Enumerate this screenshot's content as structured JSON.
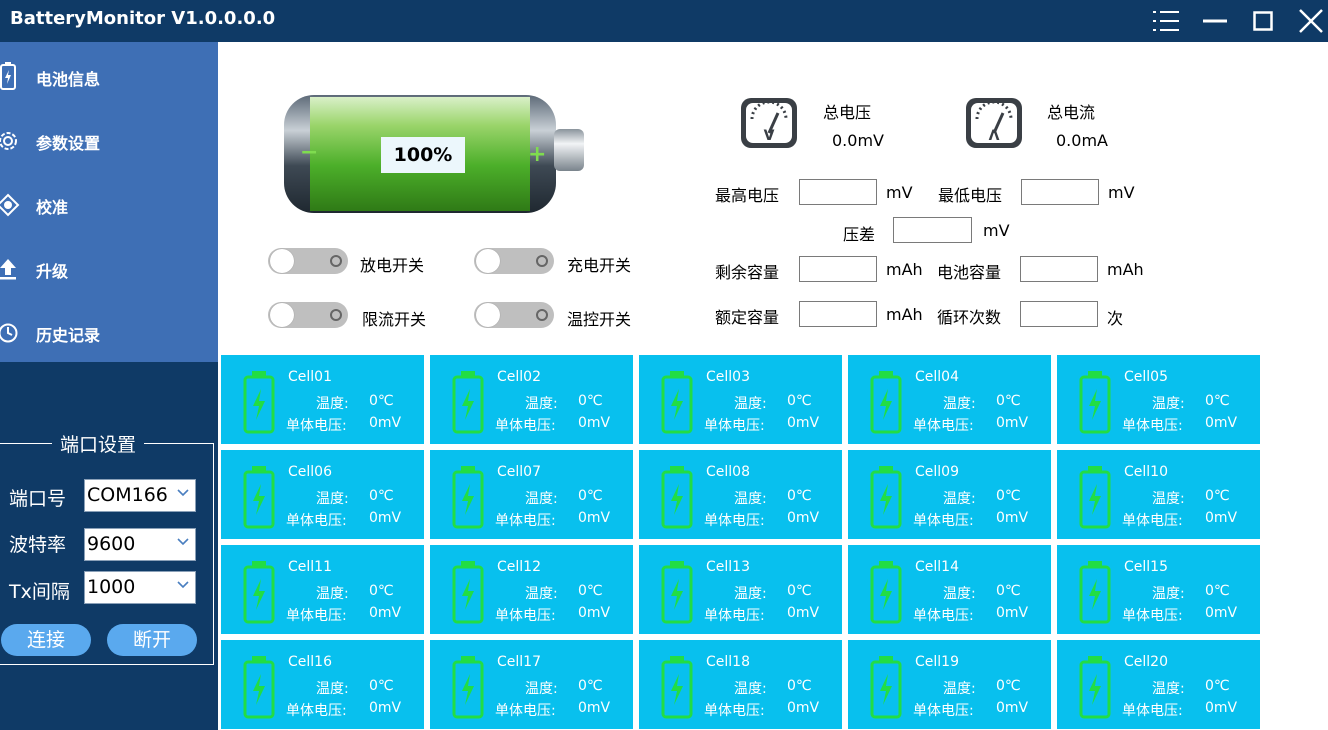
{
  "window": {
    "title": "BatteryMonitor V1.0.0.0.0",
    "buttons": [
      "menu-icon",
      "minimize-icon",
      "maximize-icon",
      "close-icon"
    ]
  },
  "sidebar": {
    "items": [
      {
        "label": "电池信息",
        "icon": "battery-icon"
      },
      {
        "label": "参数设置",
        "icon": "gear-icon"
      },
      {
        "label": "校准",
        "icon": "target-icon"
      },
      {
        "label": "升级",
        "icon": "upload-icon"
      },
      {
        "label": "历史记录",
        "icon": "clock-icon"
      }
    ]
  },
  "port": {
    "title": "端口设置",
    "port_label": "端口号",
    "port_value": "COM166",
    "baud_label": "波特率",
    "baud_value": "9600",
    "tx_label": "Tx间隔",
    "tx_value": "1000",
    "connect_label": "连接",
    "disconnect_label": "断开"
  },
  "battery": {
    "percent_text": "100%",
    "level": 1.0
  },
  "switches": [
    {
      "label": "放电开关",
      "on": false
    },
    {
      "label": "充电开关",
      "on": false
    },
    {
      "label": "限流开关",
      "on": false
    },
    {
      "label": "温控开关",
      "on": false
    }
  ],
  "metrics": {
    "total_voltage_label": "总电压",
    "total_voltage_value": "0.0mV",
    "total_current_label": "总电流",
    "total_current_value": "0.0mA",
    "max_voltage_label": "最高电压",
    "max_voltage_unit": "mV",
    "min_voltage_label": "最低电压",
    "min_voltage_unit": "mV",
    "diff_label": "压差",
    "diff_unit": "mV",
    "remain_cap_label": "剩余容量",
    "remain_cap_unit": "mAh",
    "battery_cap_label": "电池容量",
    "battery_cap_unit": "mAh",
    "rated_cap_label": "额定容量",
    "rated_cap_unit": "mAh",
    "cycle_label": "循环次数",
    "cycle_unit": "次"
  },
  "cells": [
    {
      "name": "Cell01",
      "temp_label": "温度:",
      "temp": "0℃",
      "volt_label": "单体电压:",
      "volt": "0mV"
    },
    {
      "name": "Cell02",
      "temp_label": "温度:",
      "temp": "0℃",
      "volt_label": "单体电压:",
      "volt": "0mV"
    },
    {
      "name": "Cell03",
      "temp_label": "温度:",
      "temp": "0℃",
      "volt_label": "单体电压:",
      "volt": "0mV"
    },
    {
      "name": "Cell04",
      "temp_label": "温度:",
      "temp": "0℃",
      "volt_label": "单体电压:",
      "volt": "0mV"
    },
    {
      "name": "Cell05",
      "temp_label": "温度:",
      "temp": "0℃",
      "volt_label": "单体电压:",
      "volt": "0mV"
    },
    {
      "name": "Cell06",
      "temp_label": "温度:",
      "temp": "0℃",
      "volt_label": "单体电压:",
      "volt": "0mV"
    },
    {
      "name": "Cell07",
      "temp_label": "温度:",
      "temp": "0℃",
      "volt_label": "单体电压:",
      "volt": "0mV"
    },
    {
      "name": "Cell08",
      "temp_label": "温度:",
      "temp": "0℃",
      "volt_label": "单体电压:",
      "volt": "0mV"
    },
    {
      "name": "Cell09",
      "temp_label": "温度:",
      "temp": "0℃",
      "volt_label": "单体电压:",
      "volt": "0mV"
    },
    {
      "name": "Cell10",
      "temp_label": "温度:",
      "temp": "0℃",
      "volt_label": "单体电压:",
      "volt": "0mV"
    },
    {
      "name": "Cell11",
      "temp_label": "温度:",
      "temp": "0℃",
      "volt_label": "单体电压:",
      "volt": "0mV"
    },
    {
      "name": "Cell12",
      "temp_label": "温度:",
      "temp": "0℃",
      "volt_label": "单体电压:",
      "volt": "0mV"
    },
    {
      "name": "Cell13",
      "temp_label": "温度:",
      "temp": "0℃",
      "volt_label": "单体电压:",
      "volt": "0mV"
    },
    {
      "name": "Cell14",
      "temp_label": "温度:",
      "temp": "0℃",
      "volt_label": "单体电压:",
      "volt": "0mV"
    },
    {
      "name": "Cell15",
      "temp_label": "温度:",
      "temp": "0℃",
      "volt_label": "单体电压:",
      "volt": "0mV"
    },
    {
      "name": "Cell16",
      "temp_label": "温度:",
      "temp": "0℃",
      "volt_label": "单体电压:",
      "volt": "0mV"
    },
    {
      "name": "Cell17",
      "temp_label": "温度:",
      "temp": "0℃",
      "volt_label": "单体电压:",
      "volt": "0mV"
    },
    {
      "name": "Cell18",
      "temp_label": "温度:",
      "temp": "0℃",
      "volt_label": "单体电压:",
      "volt": "0mV"
    },
    {
      "name": "Cell19",
      "temp_label": "温度:",
      "temp": "0℃",
      "volt_label": "单体电压:",
      "volt": "0mV"
    },
    {
      "name": "Cell20",
      "temp_label": "温度:",
      "temp": "0℃",
      "volt_label": "单体电压:",
      "volt": "0mV"
    }
  ],
  "colors": {
    "titlebar": "#0f3a66",
    "nav": "#3e6fb5",
    "cell_bg": "#08c0ee",
    "cell_icon": "#22dd44",
    "button": "#5aa9ee"
  }
}
